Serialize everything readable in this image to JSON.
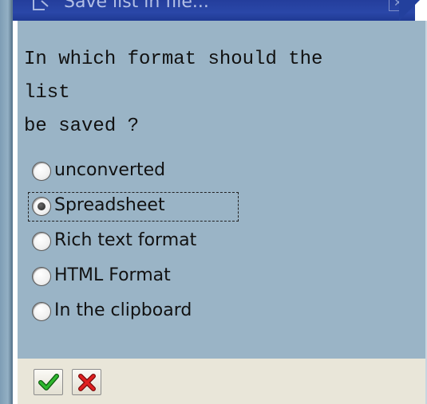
{
  "dialog": {
    "title": "Save list in file...",
    "title_icon": "document-icon",
    "close_glyph": "✕"
  },
  "question": "In which format should the\nlist\nbe saved ?",
  "options": [
    {
      "label": "unconverted",
      "checked": false
    },
    {
      "label": "Spreadsheet",
      "checked": true
    },
    {
      "label": "Rich text format",
      "checked": false
    },
    {
      "label": "HTML Format",
      "checked": false
    },
    {
      "label": "In the clipboard",
      "checked": false
    }
  ],
  "buttons": {
    "confirm_icon": "checkmark-icon",
    "cancel_icon": "cross-icon"
  },
  "colors": {
    "title_bar": "#2a47a8",
    "content_bg": "#9ab4c6",
    "footer_bg": "#e9e6d9",
    "confirm_green": "#1f9a1f",
    "cancel_red": "#d01818"
  }
}
